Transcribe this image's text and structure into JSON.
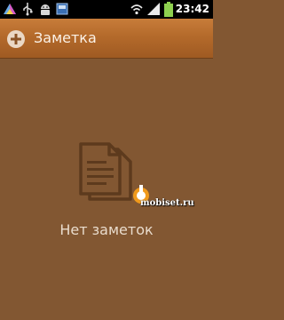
{
  "status_bar": {
    "time": "23:42",
    "icons": [
      "triangle-notification-icon",
      "usb-icon",
      "android-debug-icon",
      "sd-card-icon",
      "wifi-icon",
      "signal-icon",
      "battery-icon"
    ]
  },
  "titlebar": {
    "title": "Заметка",
    "add_icon": "plus-circle-icon"
  },
  "empty_state": {
    "icon": "notes-document-icon",
    "text": "Нет заметок"
  },
  "watermark": {
    "text": "mobiset.ru"
  },
  "colors": {
    "background": "#825732",
    "titlebar": "#b46a2b",
    "text": "#e9dccd",
    "statusbar": "#000000"
  }
}
